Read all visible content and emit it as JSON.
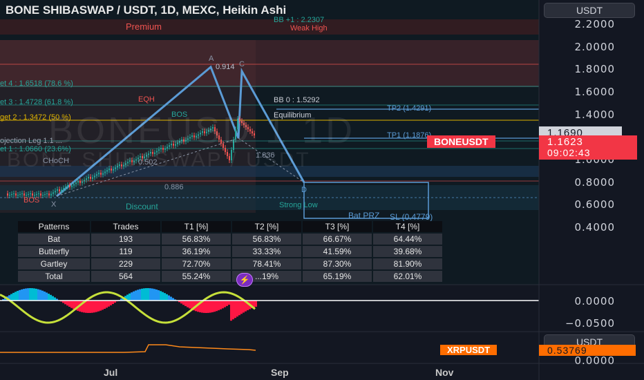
{
  "title": "BONE SHIBASWAP / USDT, 1D, MEXC, Heikin Ashi",
  "watermark_primary": "BONEUSD 1 1D",
  "watermark_secondary": "BONE SHIBASWAP / USDT",
  "price_axis": {
    "currency_button": "USDT",
    "ticks": [
      "2.2000",
      "2.0000",
      "1.8000",
      "1.6000",
      "1.4000",
      "1.0000",
      "0.8000",
      "0.6000",
      "0.4000"
    ],
    "last_price_box": "1.1690",
    "symbol_flag": "BONEUSDT",
    "current_price": "1.1623",
    "countdown": "09:02:43"
  },
  "annotations": {
    "premium": "Premium",
    "bb_upper": "BB +1 : 2.2307",
    "weak_high": "Weak High",
    "point_a": "A",
    "point_a_value": "0.914",
    "point_c": "C",
    "target4": "et 4 : 1.6518 (78.6 %)",
    "target3": "et 3 : 1.4728 (61.8 %)",
    "target2": "get 2 : 1.3472 (50 %)",
    "target1": "ojection Leg 1.1 ...",
    "target0": "et 1 : 1.0660 (23.6%)",
    "eqh": "EQH",
    "bos_top": "BOS",
    "bb0": "BB 0 : 1.5292",
    "equilibrium": "Equilibrium",
    "tp2": "TP2 (1.4291)",
    "tp1": "TP1 (1.1876)",
    "ratio_1836": "1.836",
    "ratio_0502": "0.502",
    "choch": "CHoCH",
    "ratio_0886": "0.886",
    "point_d": "D",
    "point_x": "X",
    "bos_bottom": "BOS",
    "discount": "Discount",
    "strong_low": "Strong Low",
    "bat_prz": "Bat PRZ",
    "sl": "SL (0.4779)"
  },
  "stats_table": {
    "headers": [
      "Patterns",
      "Trades",
      "T1 [%]",
      "T2 [%]",
      "T3 [%]",
      "T4 [%]"
    ],
    "rows": [
      [
        "Bat",
        "193",
        "56.83%",
        "56.83%",
        "66.67%",
        "64.44%"
      ],
      [
        "Butterfly",
        "119",
        "36.19%",
        "33.33%",
        "41.59%",
        "39.68%"
      ],
      [
        "Gartley",
        "229",
        "72.70%",
        "78.41%",
        "87.30%",
        "81.90%"
      ],
      [
        "Total",
        "564",
        "55.24%",
        "...19%",
        "65.19%",
        "62.01%"
      ]
    ]
  },
  "oscillator_axis": {
    "ticks": [
      "0.0000",
      "−0.0500"
    ]
  },
  "pane3": {
    "currency_button": "USDT",
    "symbol_flag": "XRPUSDT",
    "value": "0.53769",
    "zero_tick": "0.0000"
  },
  "time_axis": [
    "Jul",
    "Sep",
    "Nov"
  ],
  "colors": {
    "background": "#131722",
    "bull": "#26a69a",
    "bear": "#ef5350",
    "pattern_line": "#5b9bd5",
    "flag_red": "#f23645",
    "flag_orange": "#ff6d00"
  }
}
